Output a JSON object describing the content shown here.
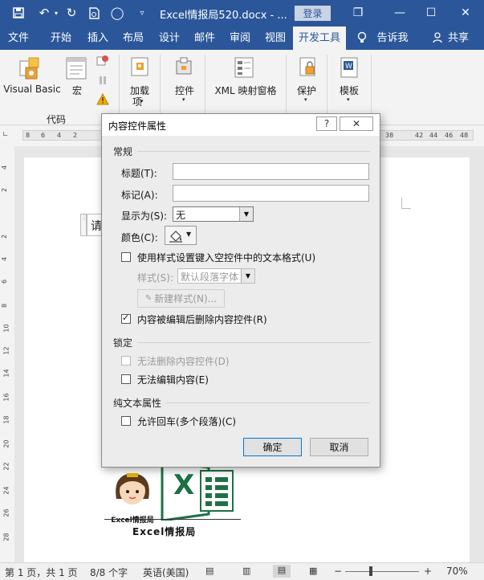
{
  "window": {
    "title": "Excel情报局520.docx  -  ...",
    "login_label": "登录",
    "controls": {
      "restore": "❐",
      "minimize": "—",
      "maximize": "☐",
      "close": "✕"
    }
  },
  "tabs": [
    "文件",
    "开始",
    "插入",
    "布局",
    "设计",
    "邮件",
    "审阅",
    "视图",
    "开发工具"
  ],
  "tell_me": "告诉我",
  "share": "共享",
  "ribbon": {
    "visual_basic": "Visual Basic",
    "macro": "宏",
    "group_code": "代码",
    "addins": "加载",
    "addins_line2": "项",
    "controls": "控件",
    "xml_pane": "XML 映射窗格",
    "protect": "保护",
    "template": "模板"
  },
  "ruler_numbers": [
    "8",
    "6",
    "4",
    "2",
    "38",
    "42",
    "44",
    "46",
    "48"
  ],
  "vruler_numbers": [
    "4",
    "2",
    "2",
    "4",
    "6",
    "8",
    "10",
    "12",
    "14",
    "16",
    "18",
    "20",
    "22",
    "24",
    "26",
    "28"
  ],
  "document": {
    "partial_char": "请",
    "logo_caption": "Excel情报局",
    "brand_caption": "Excel情报局",
    "excel_letter": "X"
  },
  "status": {
    "pages": "第 1 页，共 1 页",
    "words": "8/8 个字",
    "language": "英语(美国)",
    "zoom": "70%"
  },
  "dialog": {
    "title": "内容控件属性",
    "help_btn": "?",
    "close_btn": "✕",
    "general": "常规",
    "title_label": "标题(T):",
    "title_value": "",
    "tag_label": "标记(A):",
    "tag_value": "",
    "display_label": "显示为(S):",
    "display_value": "无",
    "color_label": "颜色(C):",
    "use_style": "使用样式设置键入空控件中的文本格式(U)",
    "style_label": "样式(S):",
    "style_value": "默认段落字体",
    "new_style": "新建样式(N)...",
    "remove_on_edit": "内容被编辑后删除内容控件(R)",
    "locking": "锁定",
    "no_delete": "无法删除内容控件(D)",
    "no_edit": "无法编辑内容(E)",
    "plain_text": "纯文本属性",
    "allow_return": "允许回车(多个段落)(C)",
    "ok": "确定",
    "cancel": "取消"
  },
  "colors": {
    "brand_blue": "#2b579a",
    "excel_green": "#1e7145"
  }
}
